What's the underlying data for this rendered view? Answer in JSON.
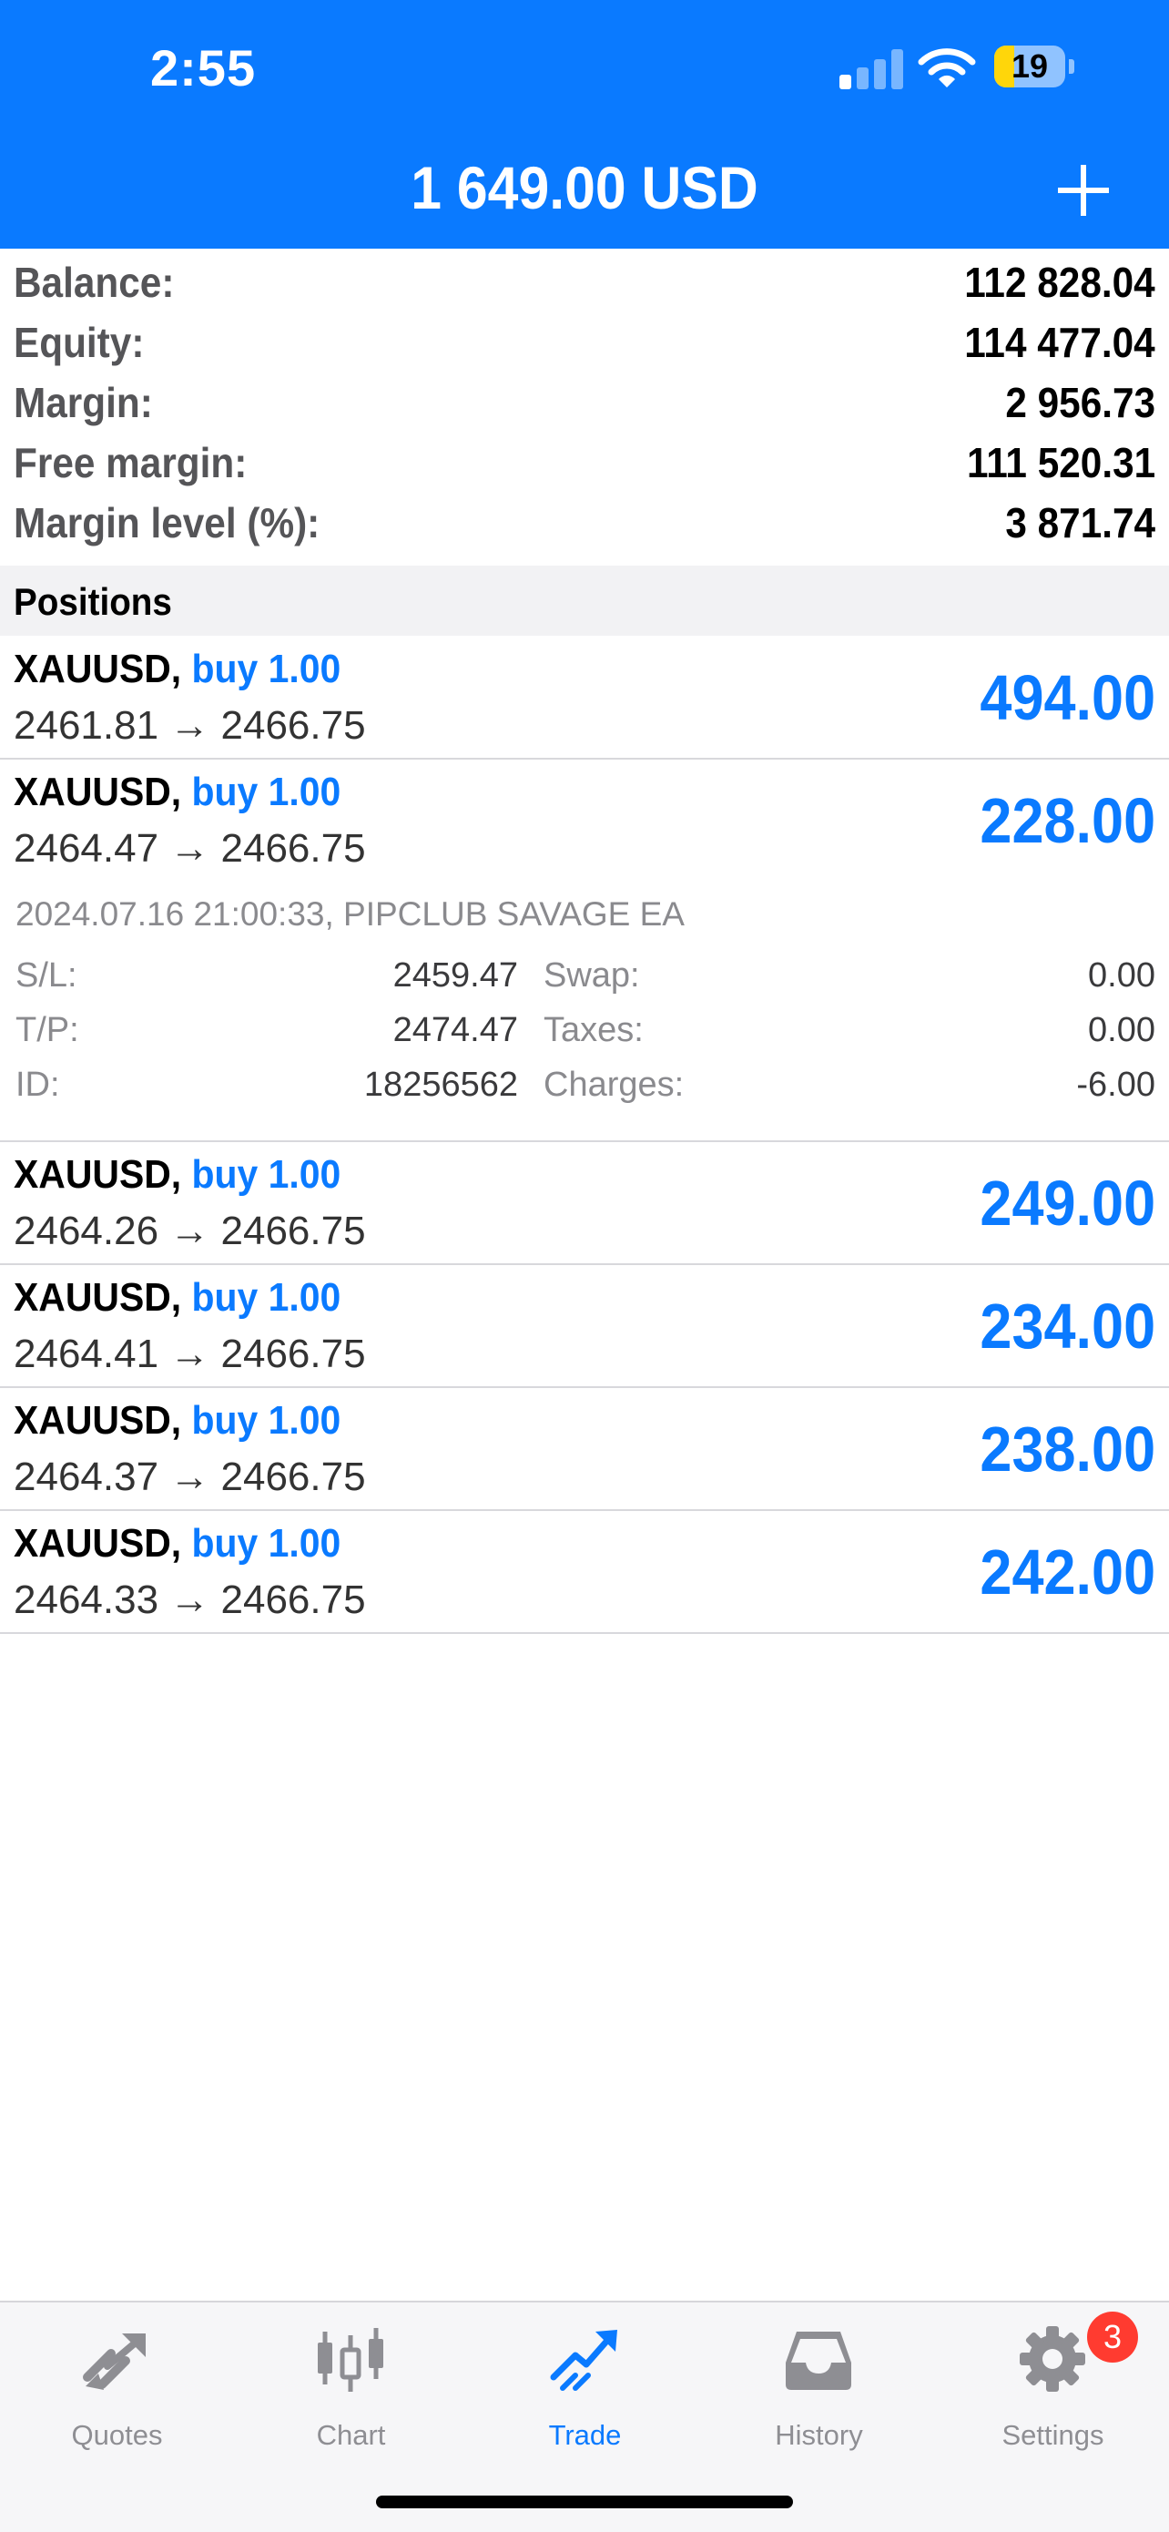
{
  "status_bar": {
    "time": "2:55",
    "battery": "19"
  },
  "header": {
    "title": "1 649.00 USD",
    "add_icon": "plus-icon"
  },
  "summary": [
    {
      "label": "Balance:",
      "value": "112 828.04"
    },
    {
      "label": "Equity:",
      "value": "114 477.04"
    },
    {
      "label": "Margin:",
      "value": "2 956.73"
    },
    {
      "label": "Free margin:",
      "value": "111 520.31"
    },
    {
      "label": "Margin level (%):",
      "value": "3 871.74"
    }
  ],
  "positions_title": "Positions",
  "positions": [
    {
      "symbol": "XAUUSD,",
      "direction": "buy 1.00",
      "prices": "2461.81 → 2466.75",
      "profit": "494.00"
    },
    {
      "symbol": "XAUUSD,",
      "direction": "buy 1.00",
      "prices": "2464.47 → 2466.75",
      "profit": "228.00"
    },
    {
      "symbol": "XAUUSD,",
      "direction": "buy 1.00",
      "prices": "2464.26 → 2466.75",
      "profit": "249.00"
    },
    {
      "symbol": "XAUUSD,",
      "direction": "buy 1.00",
      "prices": "2464.41 → 2466.75",
      "profit": "234.00"
    },
    {
      "symbol": "XAUUSD,",
      "direction": "buy 1.00",
      "prices": "2464.37 → 2466.75",
      "profit": "238.00"
    },
    {
      "symbol": "XAUUSD,",
      "direction": "buy 1.00",
      "prices": "2464.33 → 2466.75",
      "profit": "242.00"
    }
  ],
  "details": {
    "meta": "2024.07.16 21:00:33, PIPCLUB SAVAGE EA",
    "rows": [
      {
        "l1": "S/L:",
        "v1": "2459.47",
        "l2": "Swap:",
        "v2": "0.00"
      },
      {
        "l1": "T/P:",
        "v1": "2474.47",
        "l2": "Taxes:",
        "v2": "0.00"
      },
      {
        "l1": "ID:",
        "v1": "18256562",
        "l2": "Charges:",
        "v2": "-6.00"
      }
    ]
  },
  "tabs": [
    {
      "label": "Quotes",
      "icon": "quotes-icon"
    },
    {
      "label": "Chart",
      "icon": "candlestick-chart-icon"
    },
    {
      "label": "Trade",
      "icon": "trade-icon",
      "active": true
    },
    {
      "label": "History",
      "icon": "inbox-tray-icon"
    },
    {
      "label": "Settings",
      "icon": "gear-icon",
      "badge": "3"
    }
  ],
  "colors": {
    "accent": "#0a7aff",
    "badge": "#ff3b30"
  }
}
